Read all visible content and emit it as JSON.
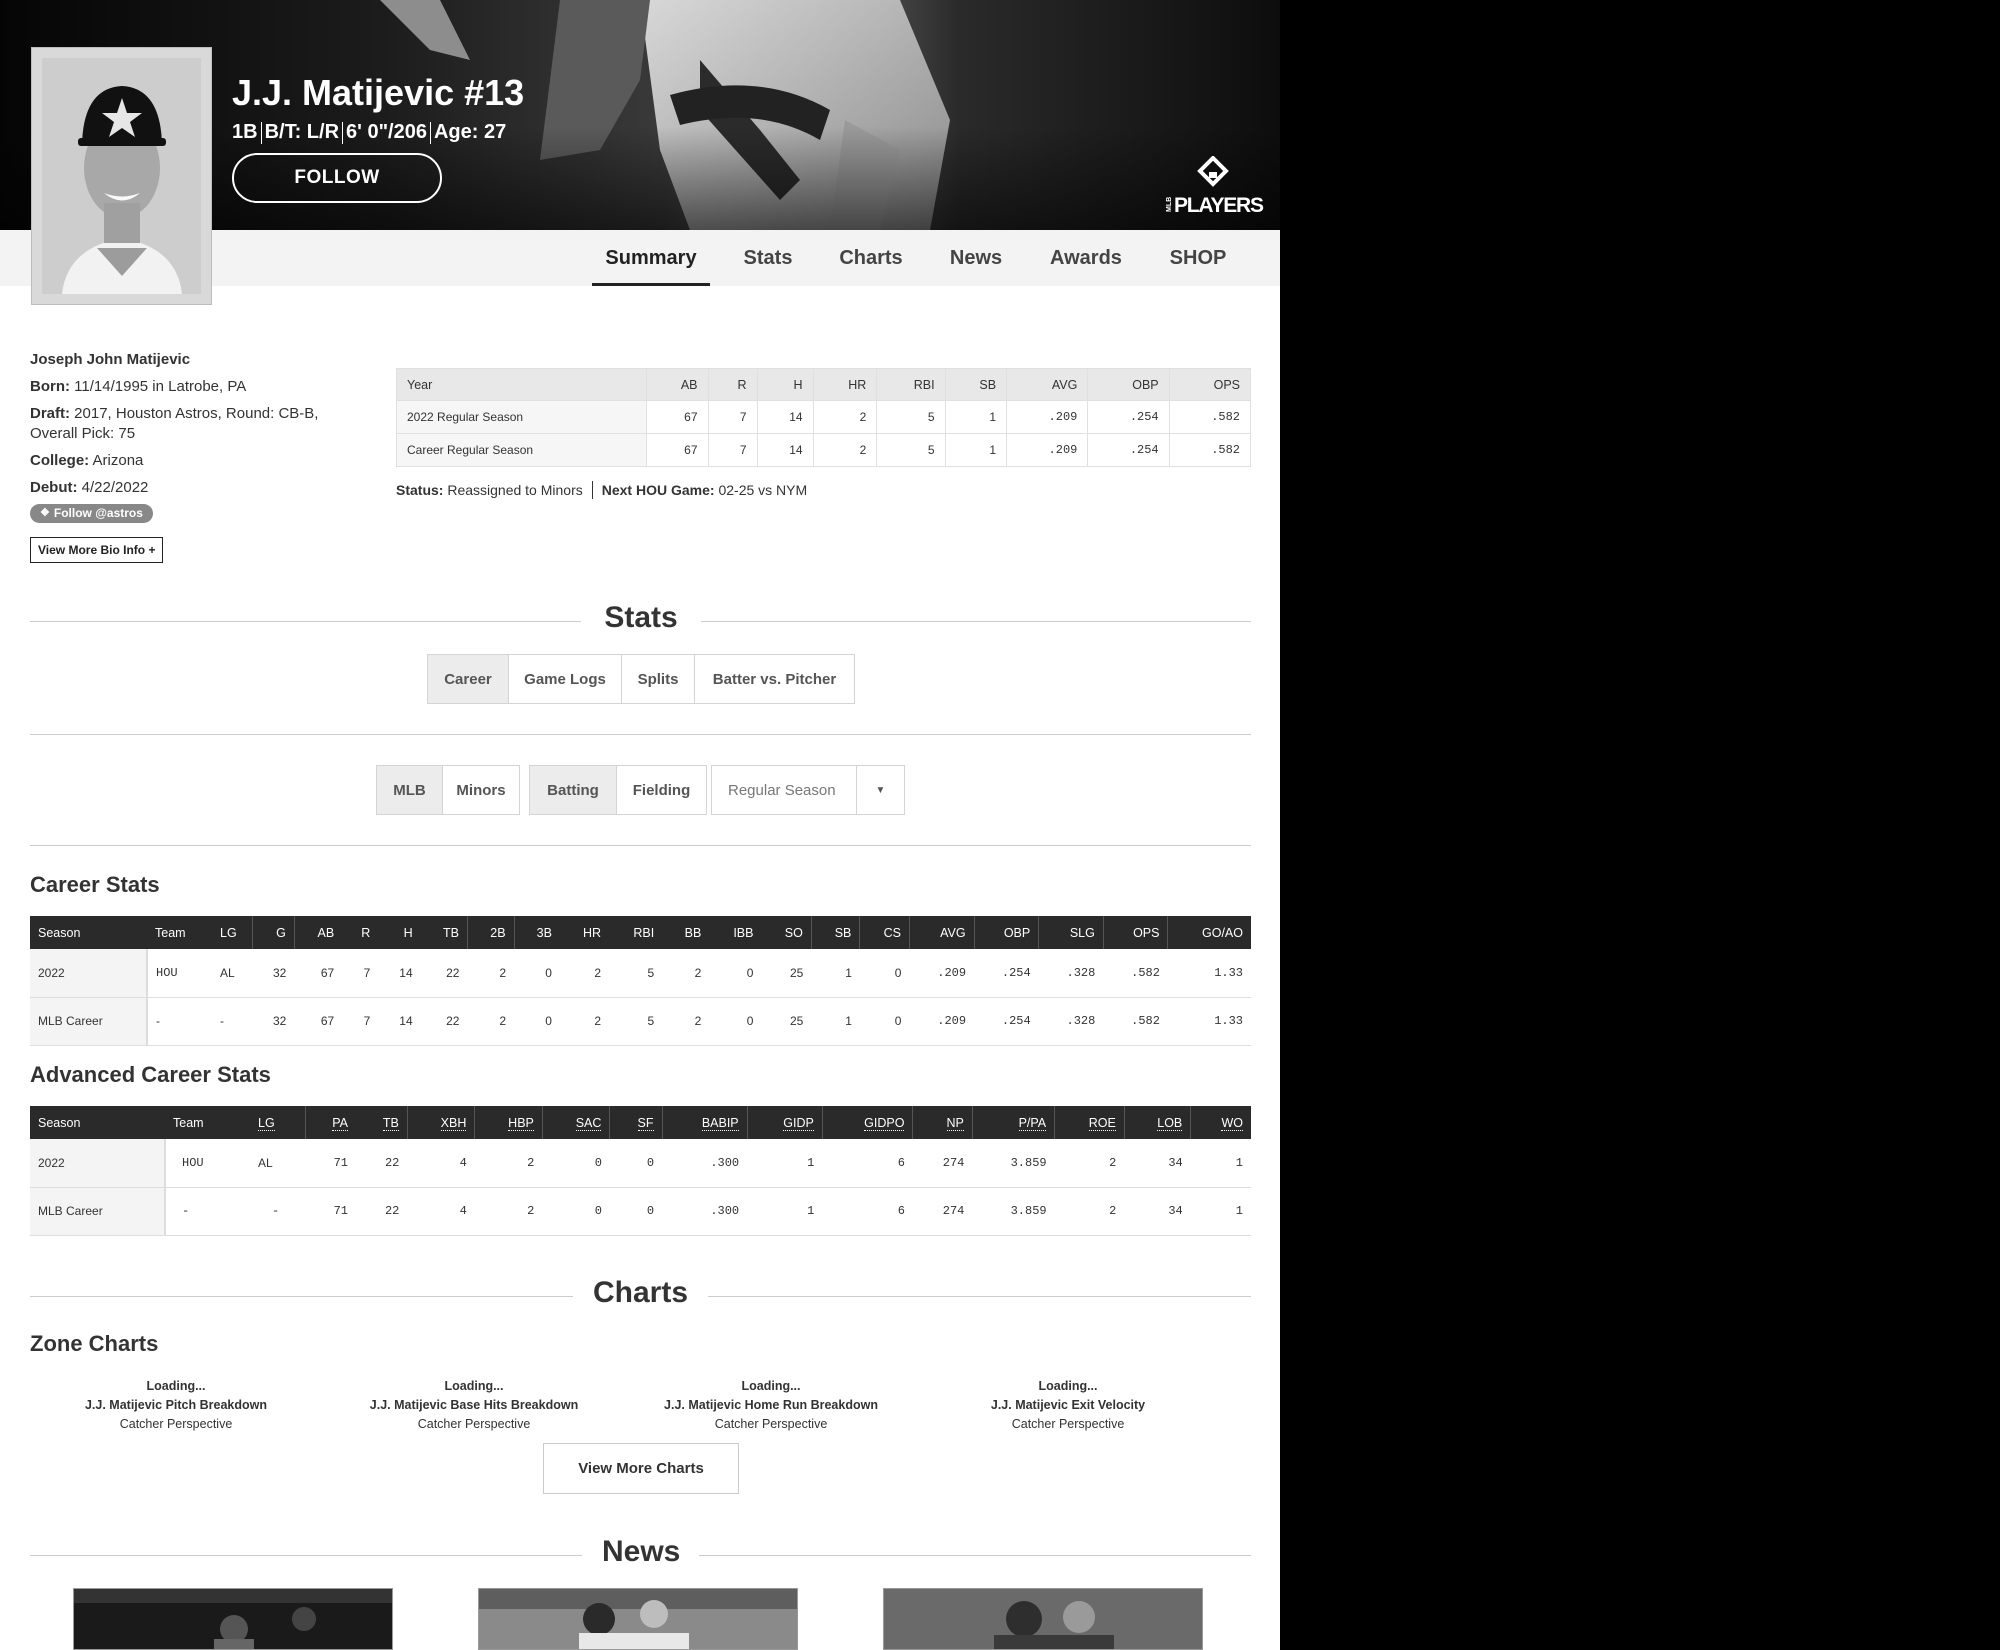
{
  "player": {
    "name": "J.J. Matijevic #13",
    "position": "1B",
    "bats_throws": "B/T: L/R",
    "height_weight": "6' 0\"/206",
    "age": "Age: 27",
    "follow_label": "FOLLOW"
  },
  "logo": {
    "text": "PLAYERS",
    "sub": "MLB"
  },
  "nav": {
    "tabs": [
      {
        "label": "Summary",
        "active": true
      },
      {
        "label": "Stats"
      },
      {
        "label": "Charts"
      },
      {
        "label": "News"
      },
      {
        "label": "Awards"
      },
      {
        "label": "SHOP"
      }
    ]
  },
  "bio": {
    "full_name": "Joseph John Matijevic",
    "born_label": "Born:",
    "born": "11/14/1995 in Latrobe, PA",
    "draft_label": "Draft:",
    "draft": "2017, Houston Astros, Round: CB-B, Overall Pick: 75",
    "college_label": "College:",
    "college": "Arizona",
    "debut_label": "Debut:",
    "debut": "4/22/2022",
    "twitter_label": "Follow @astros",
    "more_bio_label": "View More Bio Info +"
  },
  "summary": {
    "headers": [
      "Year",
      "AB",
      "R",
      "H",
      "HR",
      "RBI",
      "SB",
      "AVG",
      "OBP",
      "OPS"
    ],
    "rows": [
      [
        "2022 Regular Season",
        "67",
        "7",
        "14",
        "2",
        "5",
        "1",
        ".209",
        ".254",
        ".582"
      ],
      [
        "Career Regular Season",
        "67",
        "7",
        "14",
        "2",
        "5",
        "1",
        ".209",
        ".254",
        ".582"
      ]
    ],
    "status_label": "Status:",
    "status": "Reassigned to Minors",
    "next_game_label": "Next HOU Game:",
    "next_game": "02-25 vs NYM"
  },
  "stats_section": {
    "title": "Stats",
    "view_tabs": [
      {
        "label": "Career",
        "active": true
      },
      {
        "label": "Game Logs"
      },
      {
        "label": "Splits"
      },
      {
        "label": "Batter vs. Pitcher"
      }
    ],
    "level_tabs": [
      {
        "label": "MLB",
        "active": true
      },
      {
        "label": "Minors"
      }
    ],
    "type_tabs": [
      {
        "label": "Batting",
        "active": true
      },
      {
        "label": "Fielding"
      }
    ],
    "season_select": "Regular Season"
  },
  "career_stats": {
    "title": "Career Stats",
    "headers": [
      "Season",
      "Team",
      "LG",
      "G",
      "AB",
      "R",
      "H",
      "TB",
      "2B",
      "3B",
      "HR",
      "RBI",
      "BB",
      "IBB",
      "SO",
      "SB",
      "CS",
      "AVG",
      "OBP",
      "SLG",
      "OPS",
      "GO/AO"
    ],
    "rows": [
      [
        "2022",
        "HOU",
        "AL",
        "32",
        "67",
        "7",
        "14",
        "22",
        "2",
        "0",
        "2",
        "5",
        "2",
        "0",
        "25",
        "1",
        "0",
        ".209",
        ".254",
        ".328",
        ".582",
        "1.33"
      ],
      [
        "MLB Career",
        "-",
        "-",
        "32",
        "67",
        "7",
        "14",
        "22",
        "2",
        "0",
        "2",
        "5",
        "2",
        "0",
        "25",
        "1",
        "0",
        ".209",
        ".254",
        ".328",
        ".582",
        "1.33"
      ]
    ]
  },
  "advanced_stats": {
    "title": "Advanced Career Stats",
    "headers": [
      "Season",
      "Team",
      "LG",
      "PA",
      "TB",
      "XBH",
      "HBP",
      "SAC",
      "SF",
      "BABIP",
      "GIDP",
      "GIDPO",
      "NP",
      "P/PA",
      "ROE",
      "LOB",
      "WO"
    ],
    "rows": [
      [
        "2022",
        "HOU",
        "AL",
        "71",
        "22",
        "4",
        "2",
        "0",
        "0",
        ".300",
        "1",
        "6",
        "274",
        "3.859",
        "2",
        "34",
        "1"
      ],
      [
        "MLB Career",
        "-",
        "-",
        "71",
        "22",
        "4",
        "2",
        "0",
        "0",
        ".300",
        "1",
        "6",
        "274",
        "3.859",
        "2",
        "34",
        "1"
      ]
    ]
  },
  "charts_section": {
    "title": "Charts",
    "zone_title": "Zone Charts",
    "charts": [
      {
        "loading": "Loading...",
        "title": "J.J. Matijevic Pitch Breakdown",
        "perspective": "Catcher Perspective"
      },
      {
        "loading": "Loading...",
        "title": "J.J. Matijevic Base Hits Breakdown",
        "perspective": "Catcher Perspective"
      },
      {
        "loading": "Loading...",
        "title": "J.J. Matijevic Home Run Breakdown",
        "perspective": "Catcher Perspective"
      },
      {
        "loading": "Loading...",
        "title": "J.J. Matijevic Exit Velocity",
        "perspective": "Catcher Perspective"
      }
    ],
    "view_more_label": "View More Charts"
  },
  "news_section": {
    "title": "News"
  },
  "colors": {
    "header_bg": "#2a2a2a",
    "nav_bg": "#f3f3f3",
    "active_btn": "#ececec"
  }
}
